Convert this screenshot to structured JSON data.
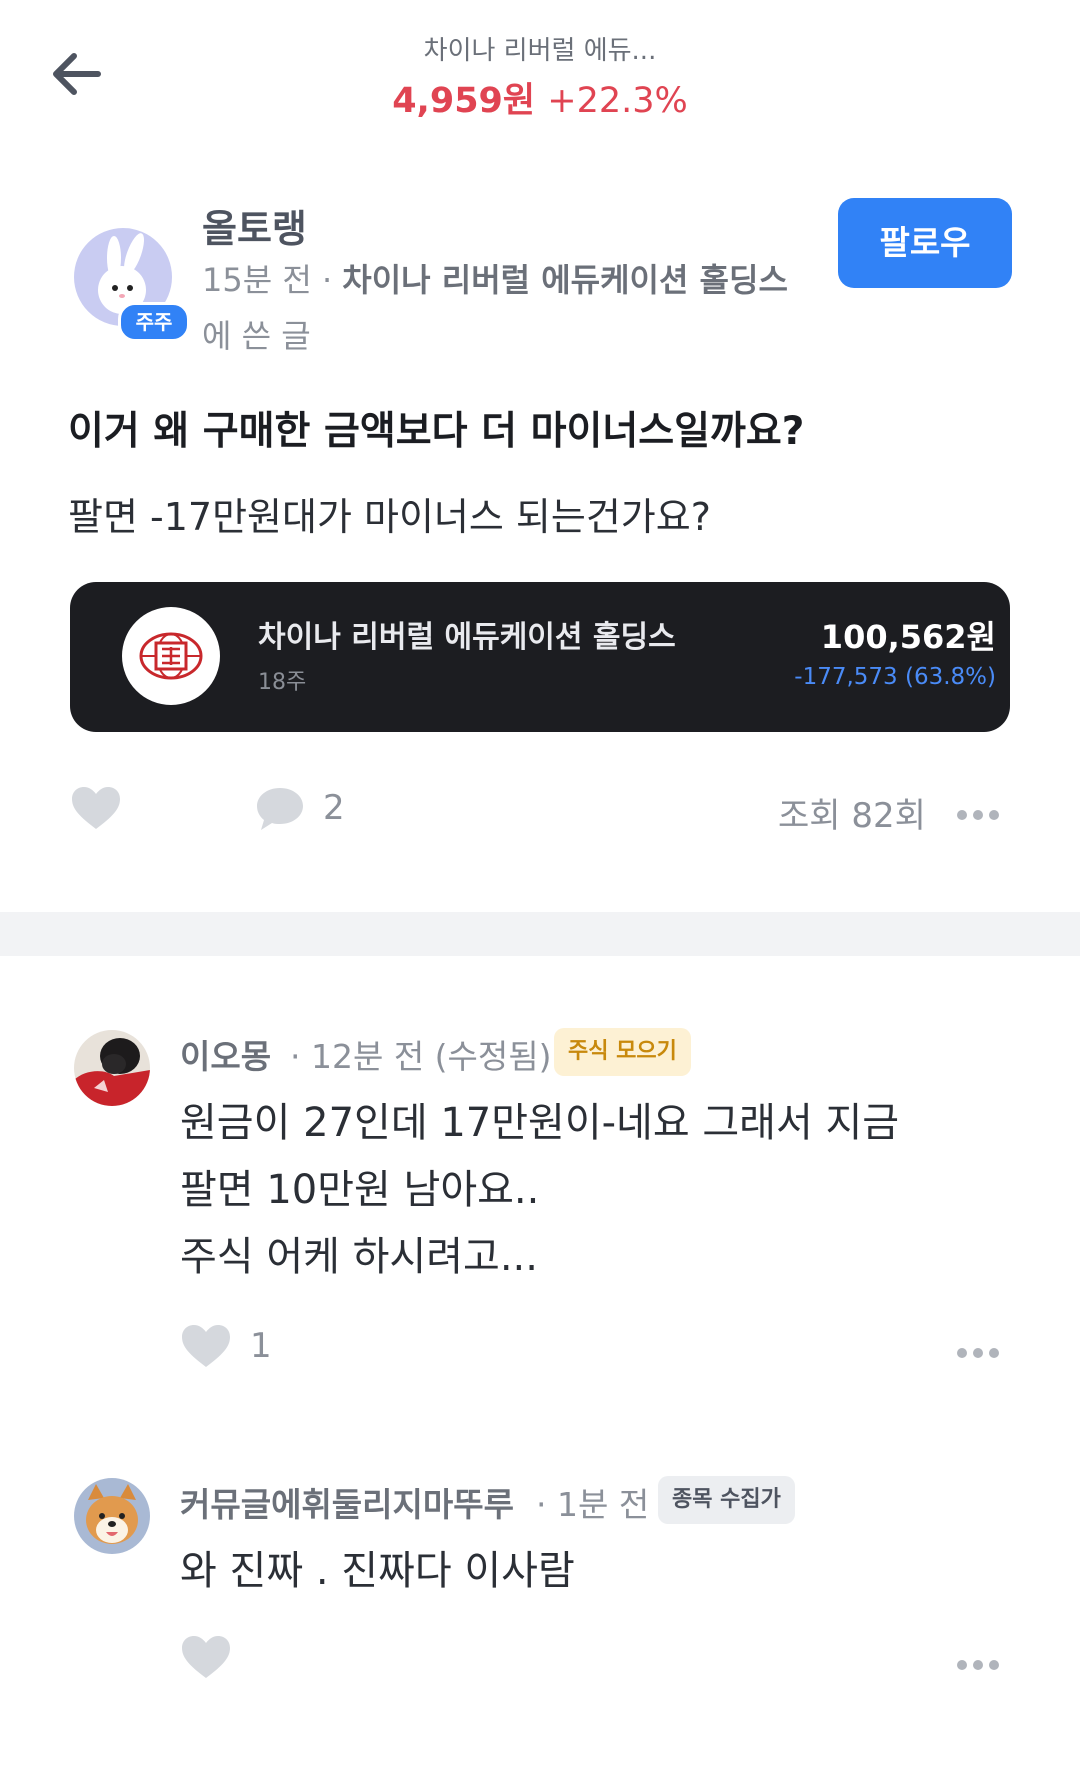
{
  "header": {
    "stock_title": "차이나 리버럴 에듀...",
    "price": "4,959원",
    "change": "+22.3%"
  },
  "post": {
    "author": "올토랭",
    "holder_badge": "주주",
    "time": "15분 전",
    "stock_ref": "차이나 리버럴 에듀케이션 홀딩스",
    "suffix": "에 쓴 글",
    "follow_label": "팔로우",
    "title": "이거 왜 구매한 금액보다 더 마이너스일까요?",
    "body": "팔면 -17만원대가 마이너스 되는건가요?",
    "stock_card": {
      "name": "차이나 리버럴 에듀케이션 홀딩스",
      "quantity": "18주",
      "amount": "100,562원",
      "change": "-177,573 (63.8%)"
    },
    "comment_count": "2",
    "views": "조회 82회"
  },
  "comments": [
    {
      "name": "이오몽",
      "time": "12분 전 (수정됨)",
      "tag": "주식 모으기",
      "lines": [
        "원금이 27인데 17만원이-네요 그래서 지금",
        "팔면 10만원 남아요..",
        "주식 어케 하시려고..."
      ],
      "likes": "1"
    },
    {
      "name": "커뮤글에휘둘리지마뚜루",
      "time": "1분 전",
      "tag": "종목 수집가",
      "lines": [
        "와 진짜 . 진짜다 이사람"
      ],
      "likes": ""
    }
  ],
  "colors": {
    "accent": "#3182f6",
    "price_up": "#e04452",
    "loss_blue": "#4a8bf7",
    "card_bg": "#1c1d21"
  },
  "icons": [
    "back-arrow-icon",
    "heart-icon",
    "comment-bubble-icon",
    "more-dots-icon",
    "rabbit-avatar",
    "stock-logo-icon"
  ]
}
